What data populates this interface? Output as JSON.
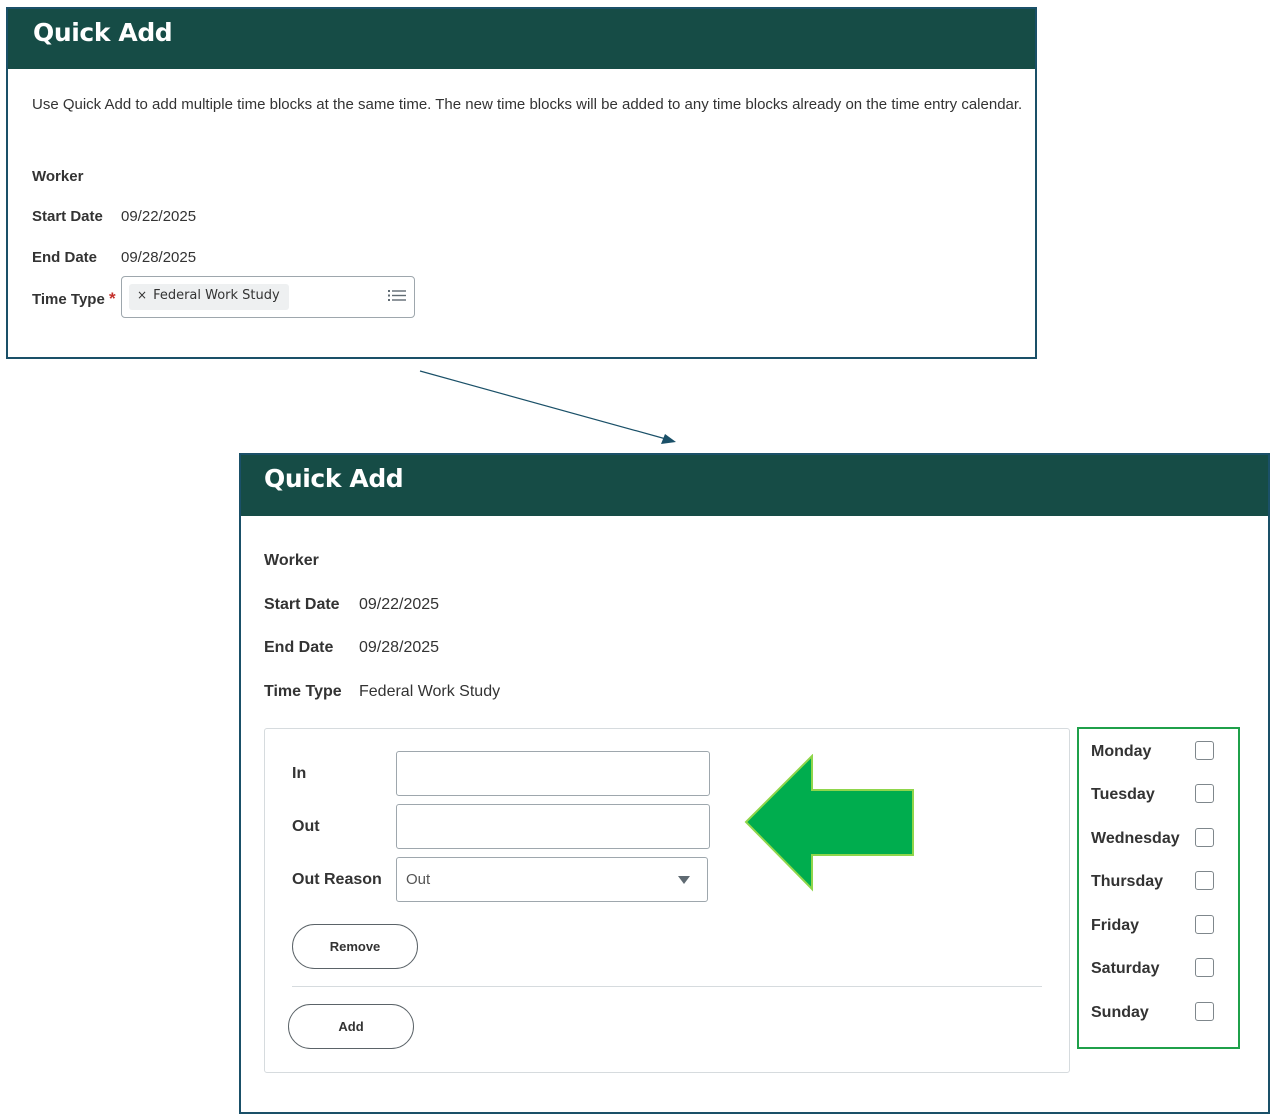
{
  "colors": {
    "header_bg": "#164c46",
    "panel_border": "#1a5068",
    "arrow_green": "#00ad4e",
    "days_border": "#1fa04a",
    "required": "#c4302b"
  },
  "panel1": {
    "title": "Quick Add",
    "description": "Use Quick Add to add multiple time blocks at the same time. The new time blocks will be added to any time blocks already on the time entry calendar.",
    "worker_label": "Worker",
    "start_date_label": "Start Date",
    "start_date": "09/22/2025",
    "end_date_label": "End Date",
    "end_date": "09/28/2025",
    "time_type_label": "Time Type",
    "required_mark": "*",
    "time_type_chip": "Federal Work Study",
    "chip_remove_icon": "×"
  },
  "panel2": {
    "title": "Quick Add",
    "worker_label": "Worker",
    "start_date_label": "Start Date",
    "start_date": "09/22/2025",
    "end_date_label": "End Date",
    "end_date": "09/28/2025",
    "time_type_label": "Time Type",
    "time_type": "Federal Work Study",
    "in_label": "In",
    "in_value": "",
    "out_label": "Out",
    "out_value": "",
    "out_reason_label": "Out Reason",
    "out_reason_value": "Out",
    "remove_label": "Remove",
    "add_label": "Add",
    "days": [
      "Monday",
      "Tuesday",
      "Wednesday",
      "Thursday",
      "Friday",
      "Saturday",
      "Sunday"
    ]
  }
}
